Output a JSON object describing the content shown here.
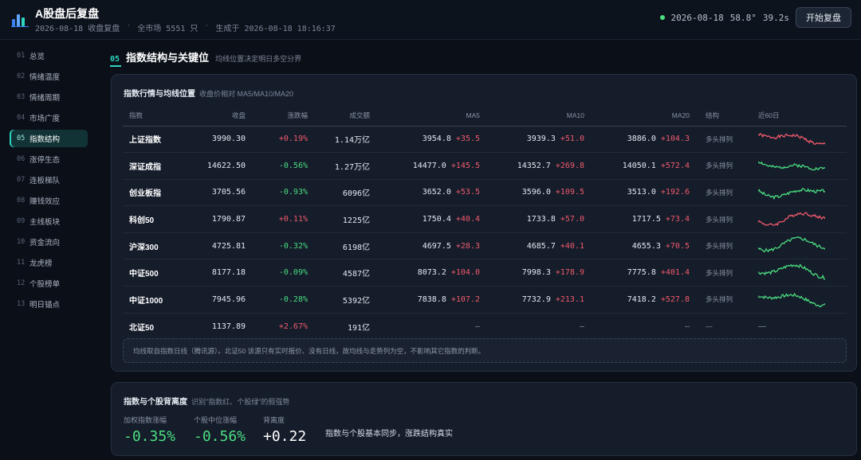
{
  "header": {
    "title": "A股盘后复盘",
    "meta": [
      "2026-08-18 收盘复盘",
      "全市场 5551 只",
      "生成于 2026-08-18 18:16:37"
    ],
    "date": "2026-08-18",
    "stat1": "58.8°",
    "stat2": "39.2s",
    "start_button": "开始复盘",
    "live_color": "#4ade80"
  },
  "sidebar": {
    "items": [
      {
        "num": "01",
        "label": "总览"
      },
      {
        "num": "02",
        "label": "情绪温度"
      },
      {
        "num": "03",
        "label": "情绪周期"
      },
      {
        "num": "04",
        "label": "市场广度"
      },
      {
        "num": "05",
        "label": "指数结构",
        "active": true
      },
      {
        "num": "06",
        "label": "涨停生态"
      },
      {
        "num": "07",
        "label": "连板梯队"
      },
      {
        "num": "08",
        "label": "赚钱效应"
      },
      {
        "num": "09",
        "label": "主线板块"
      },
      {
        "num": "10",
        "label": "资金流向"
      },
      {
        "num": "11",
        "label": "龙虎榜"
      },
      {
        "num": "12",
        "label": "个股榜单"
      },
      {
        "num": "13",
        "label": "明日锚点"
      }
    ]
  },
  "section": {
    "num": "05",
    "title": "指数结构与关键位",
    "subtitle": "均线位置决定明日多空分界"
  },
  "index_card": {
    "title": "指数行情与均线位置",
    "hint": "收盘价相对 MA5/MA10/MA20",
    "columns": [
      "指数",
      "收盘",
      "涨跌幅",
      "成交额",
      "MA5",
      "MA10",
      "MA20",
      "结构",
      "近60日"
    ],
    "rows": [
      {
        "name": "上证指数",
        "close": "3990.30",
        "chg": "+0.19%",
        "chg_dir": "up",
        "amount": "1.14万亿",
        "ma5": "3954.8",
        "ma5_diff": "+35.5",
        "ma10": "3939.3",
        "ma10_diff": "+51.0",
        "ma20": "3886.0",
        "ma20_diff": "+104.3",
        "structure": "多头排列",
        "spark_color": "#f05b6c"
      },
      {
        "name": "深证成指",
        "close": "14622.50",
        "chg": "-0.56%",
        "chg_dir": "down",
        "amount": "1.27万亿",
        "ma5": "14477.0",
        "ma5_diff": "+145.5",
        "ma10": "14352.7",
        "ma10_diff": "+269.8",
        "ma20": "14050.1",
        "ma20_diff": "+572.4",
        "structure": "多头排列",
        "spark_color": "#4ade80"
      },
      {
        "name": "创业板指",
        "close": "3705.56",
        "chg": "-0.93%",
        "chg_dir": "down",
        "amount": "6096亿",
        "ma5": "3652.0",
        "ma5_diff": "+53.5",
        "ma10": "3596.0",
        "ma10_diff": "+109.5",
        "ma20": "3513.0",
        "ma20_diff": "+192.6",
        "structure": "多头排列",
        "spark_color": "#4ade80"
      },
      {
        "name": "科创50",
        "close": "1790.87",
        "chg": "+0.11%",
        "chg_dir": "up",
        "amount": "1225亿",
        "ma5": "1750.4",
        "ma5_diff": "+40.4",
        "ma10": "1733.8",
        "ma10_diff": "+57.0",
        "ma20": "1717.5",
        "ma20_diff": "+73.4",
        "structure": "多头排列",
        "spark_color": "#f05b6c"
      },
      {
        "name": "沪深300",
        "close": "4725.81",
        "chg": "-0.32%",
        "chg_dir": "down",
        "amount": "6198亿",
        "ma5": "4697.5",
        "ma5_diff": "+28.3",
        "ma10": "4685.7",
        "ma10_diff": "+40.1",
        "ma20": "4655.3",
        "ma20_diff": "+70.5",
        "structure": "多头排列",
        "spark_color": "#4ade80"
      },
      {
        "name": "中证500",
        "close": "8177.18",
        "chg": "-0.09%",
        "chg_dir": "down",
        "amount": "4587亿",
        "ma5": "8073.2",
        "ma5_diff": "+104.0",
        "ma10": "7998.3",
        "ma10_diff": "+178.9",
        "ma20": "7775.8",
        "ma20_diff": "+401.4",
        "structure": "多头排列",
        "spark_color": "#4ade80"
      },
      {
        "name": "中证1000",
        "close": "7945.96",
        "chg": "-0.28%",
        "chg_dir": "down",
        "amount": "5392亿",
        "ma5": "7838.8",
        "ma5_diff": "+107.2",
        "ma10": "7732.9",
        "ma10_diff": "+213.1",
        "ma20": "7418.2",
        "ma20_diff": "+527.8",
        "structure": "多头排列",
        "spark_color": "#4ade80"
      },
      {
        "name": "北证50",
        "close": "1137.89",
        "chg": "+2.67%",
        "chg_dir": "up",
        "amount": "191亿",
        "ma5": "—",
        "ma5_diff": "",
        "ma10": "—",
        "ma10_diff": "",
        "ma20": "—",
        "ma20_diff": "",
        "structure": "—",
        "spark": "—"
      }
    ],
    "note": "均线取自指数日线（腾讯源）。北证50 该源只有实时报价、没有日线，故均线与走势列为空，不影响其它指数的判断。"
  },
  "divergence_card": {
    "title": "指数与个股背离度",
    "hint": "识别\"指数红、个股绿\"的假强势",
    "metrics": [
      {
        "label": "加权指数涨幅",
        "value": "-0.35%",
        "color": "#4ade80"
      },
      {
        "label": "个股中位涨幅",
        "value": "-0.56%",
        "color": "#4ade80"
      },
      {
        "label": "背离度",
        "value": "+0.22",
        "color": "#ffffff"
      }
    ],
    "conclusion": "指数与个股基本同步，涨跌结构真实"
  },
  "colors": {
    "accent": "#2dd4bf",
    "up": "#f05b6c",
    "down": "#4ade80"
  }
}
